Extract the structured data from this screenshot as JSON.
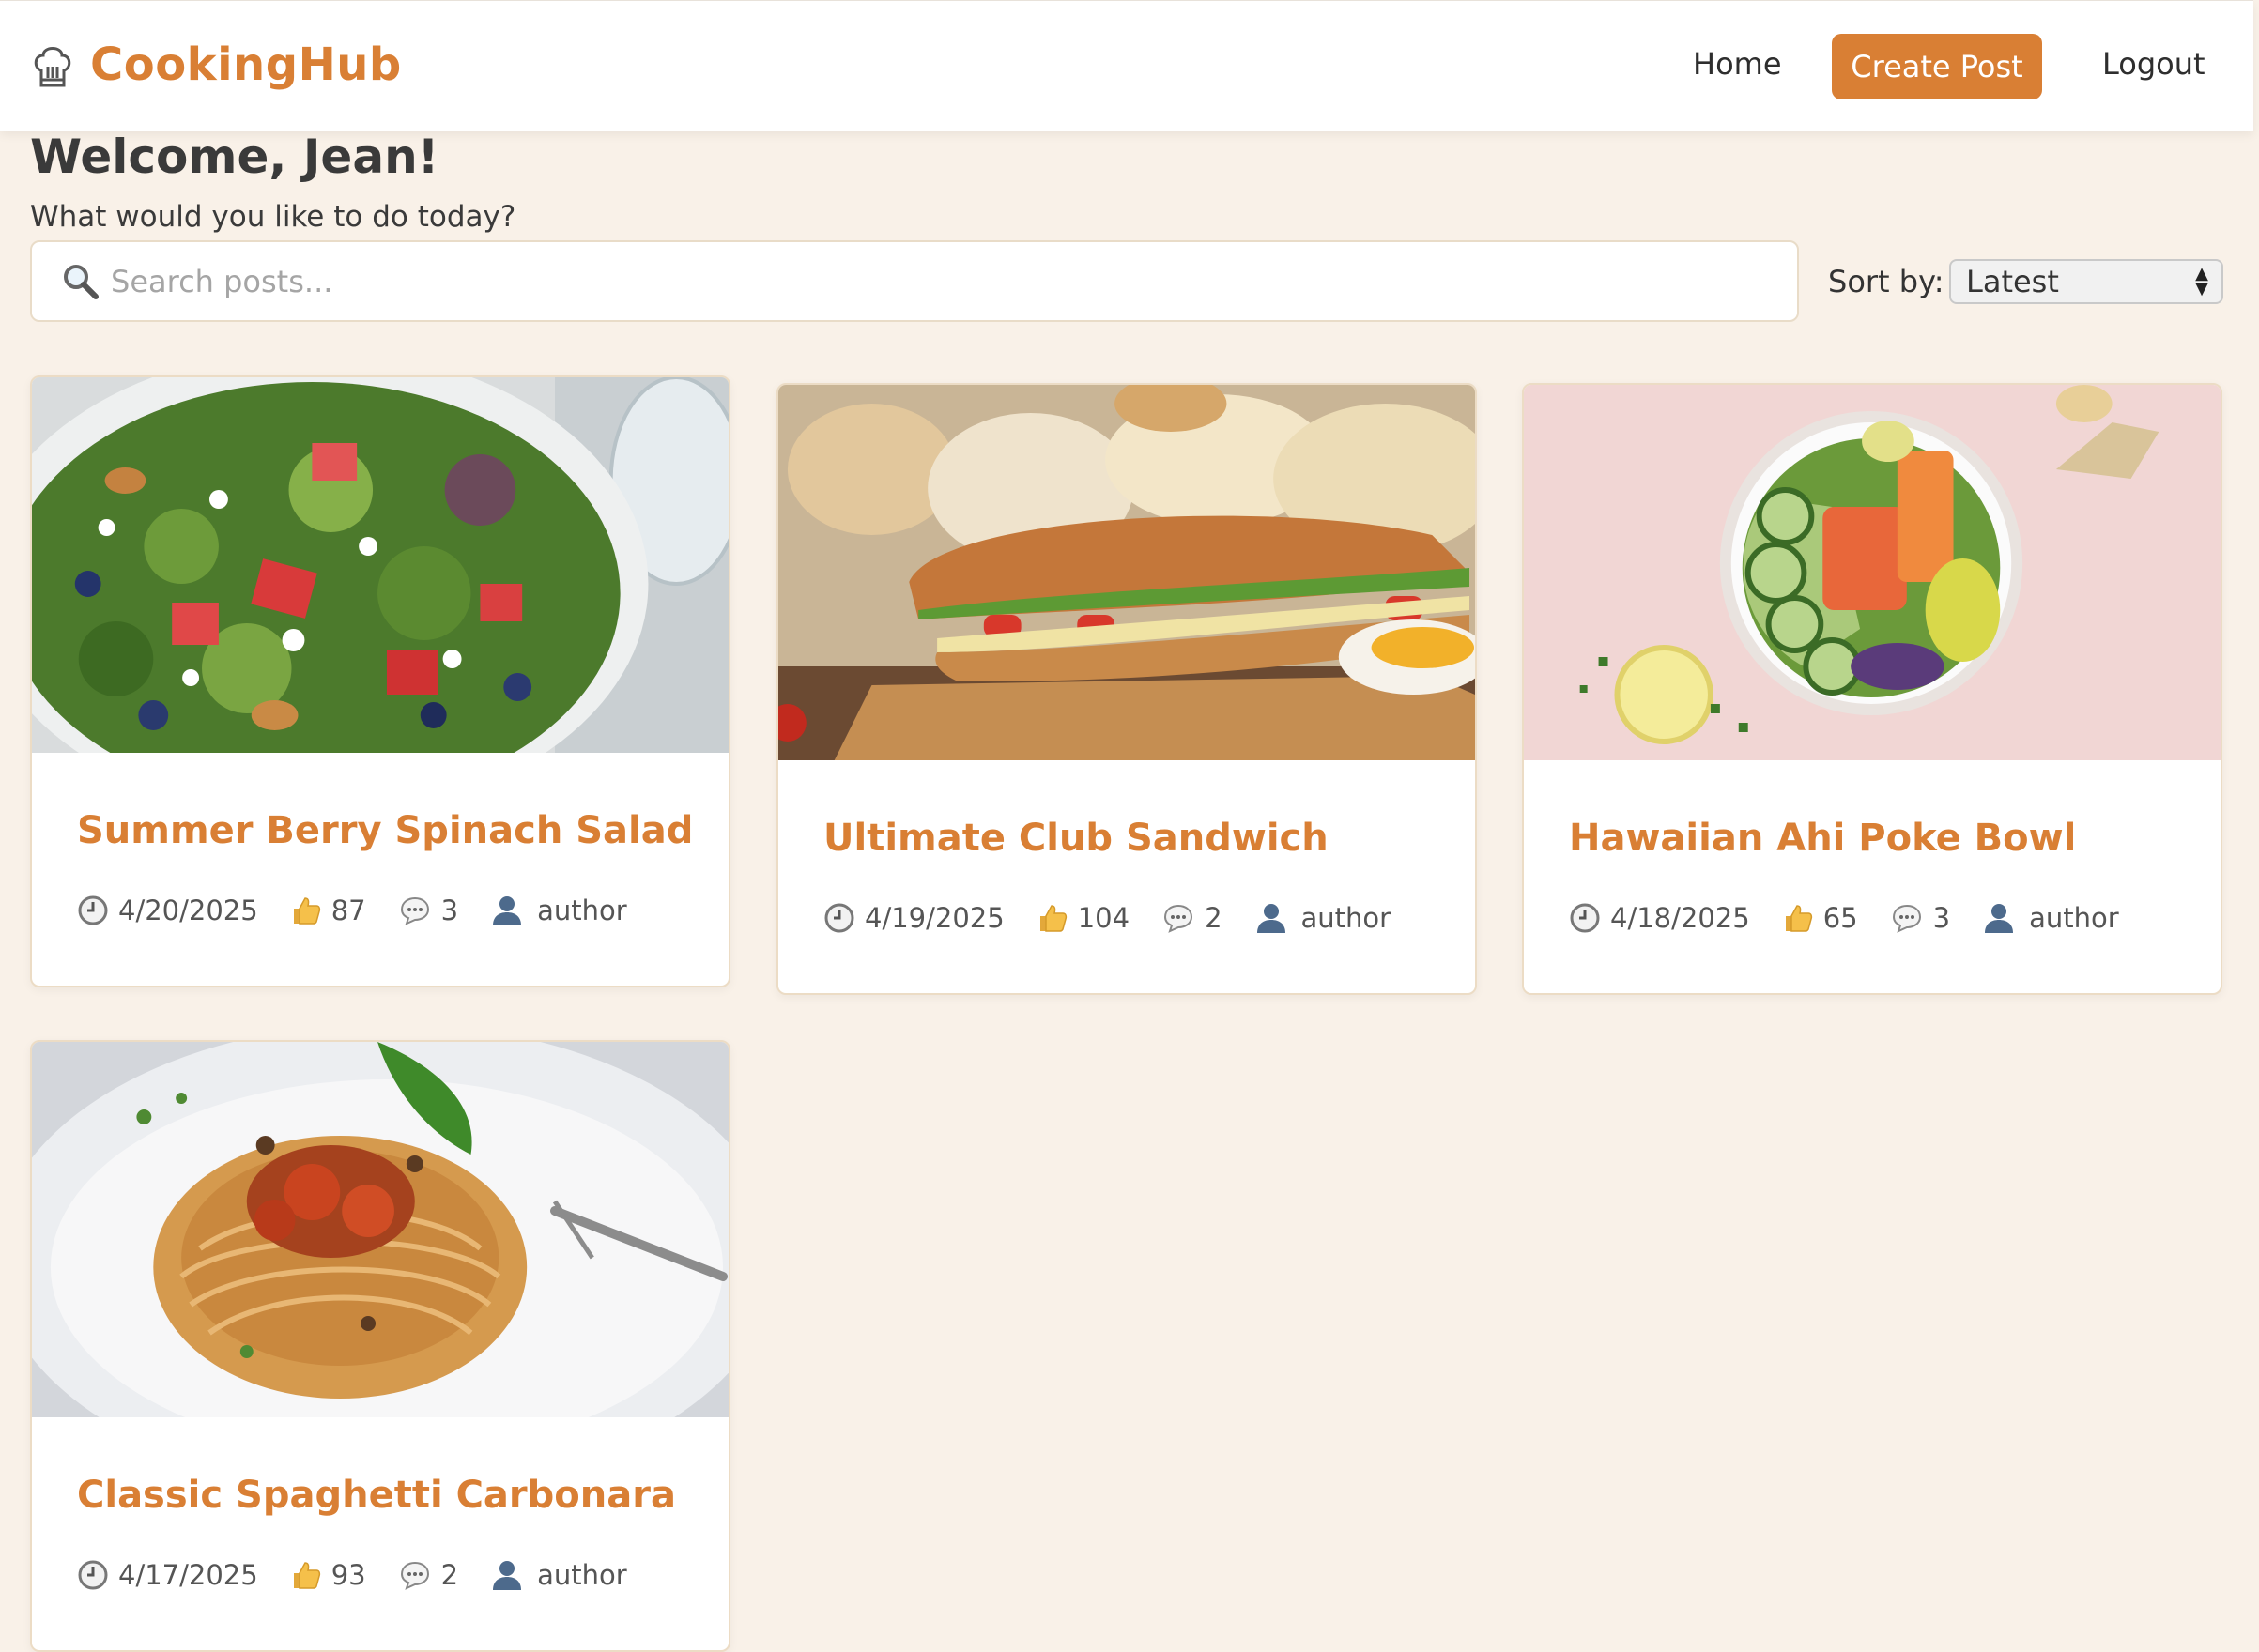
{
  "nav": {
    "brand": "CookingHub",
    "home": "Home",
    "create_post": "Create Post",
    "logout": "Logout"
  },
  "welcome": {
    "title": "Welcome, Jean!",
    "subtitle": "What would you like to do today?"
  },
  "search": {
    "placeholder": "Search posts..."
  },
  "sort": {
    "label": "Sort by:",
    "selected": "Latest"
  },
  "colors": {
    "accent": "#d97f34",
    "background": "#f9f1e8"
  },
  "posts": [
    {
      "title": "Summer Berry Spinach Salad",
      "date": "4/20/2025",
      "likes": "87",
      "comments": "3",
      "author": "author",
      "image": "salad-photo"
    },
    {
      "title": "Ultimate Club Sandwich",
      "date": "4/19/2025",
      "likes": "104",
      "comments": "2",
      "author": "author",
      "image": "sandwich-photo"
    },
    {
      "title": "Hawaiian Ahi Poke Bowl",
      "date": "4/18/2025",
      "likes": "65",
      "comments": "3",
      "author": "author",
      "image": "poke-bowl-photo"
    },
    {
      "title": "Classic Spaghetti Carbonara",
      "date": "4/17/2025",
      "likes": "93",
      "comments": "2",
      "author": "author",
      "image": "spaghetti-photo"
    }
  ],
  "icons": {
    "brand": "chef-hat-icon",
    "search": "search-icon",
    "date": "clock-icon",
    "likes": "thumbs-up-icon",
    "comments": "comment-icon",
    "author": "user-icon"
  }
}
